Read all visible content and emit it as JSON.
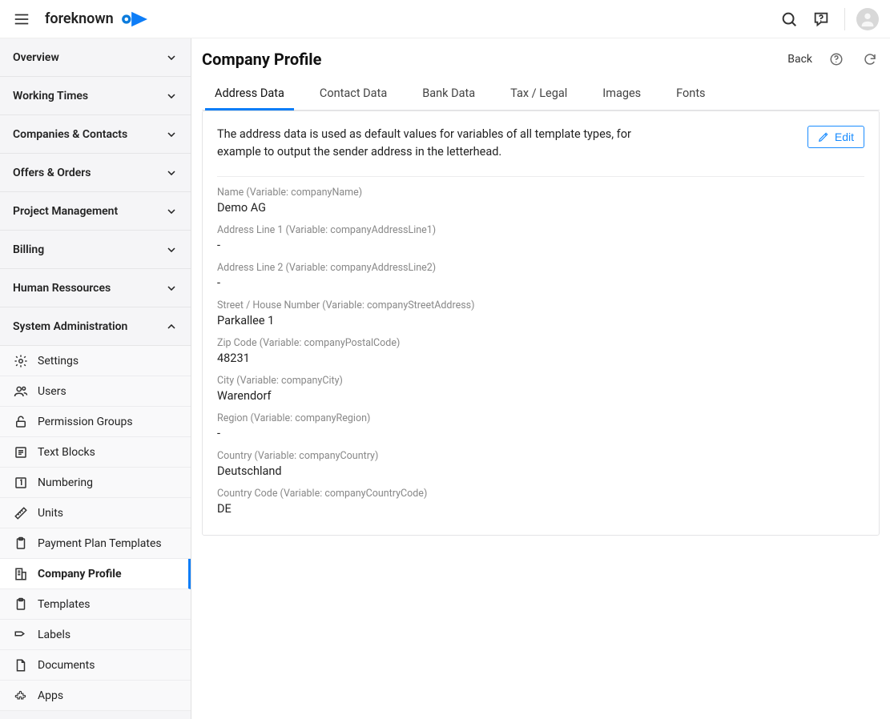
{
  "header": {
    "brand": "foreknown"
  },
  "sidebar": {
    "sections": [
      {
        "label": "Overview",
        "expanded": false
      },
      {
        "label": "Working Times",
        "expanded": false
      },
      {
        "label": "Companies & Contacts",
        "expanded": false
      },
      {
        "label": "Offers & Orders",
        "expanded": false
      },
      {
        "label": "Project Management",
        "expanded": false
      },
      {
        "label": "Billing",
        "expanded": false
      },
      {
        "label": "Human Ressources",
        "expanded": false
      },
      {
        "label": "System Administration",
        "expanded": true
      }
    ],
    "sysadmin_items": [
      {
        "label": "Settings"
      },
      {
        "label": "Users"
      },
      {
        "label": "Permission Groups"
      },
      {
        "label": "Text Blocks"
      },
      {
        "label": "Numbering"
      },
      {
        "label": "Units"
      },
      {
        "label": "Payment Plan Templates"
      },
      {
        "label": "Company Profile",
        "active": true
      },
      {
        "label": "Templates"
      },
      {
        "label": "Labels"
      },
      {
        "label": "Documents"
      },
      {
        "label": "Apps"
      }
    ]
  },
  "main": {
    "title": "Company Profile",
    "back_label": "Back",
    "tabs": [
      {
        "label": "Address Data",
        "active": true
      },
      {
        "label": "Contact Data"
      },
      {
        "label": "Bank Data"
      },
      {
        "label": "Tax / Legal"
      },
      {
        "label": "Images"
      },
      {
        "label": "Fonts"
      }
    ],
    "description": "The address data is used as default values for variables of all template types, for example to output the sender address in the letterhead.",
    "edit_label": "Edit",
    "fields": [
      {
        "label": "Name (Variable: companyName)",
        "value": "Demo AG"
      },
      {
        "label": "Address Line 1 (Variable: companyAddressLine1)",
        "value": "-"
      },
      {
        "label": "Address Line 2 (Variable: companyAddressLine2)",
        "value": "-"
      },
      {
        "label": "Street / House Number (Variable: companyStreetAddress)",
        "value": "Parkallee 1"
      },
      {
        "label": "Zip Code (Variable: companyPostalCode)",
        "value": "48231"
      },
      {
        "label": "City (Variable: companyCity)",
        "value": "Warendorf"
      },
      {
        "label": "Region (Variable: companyRegion)",
        "value": "-"
      },
      {
        "label": "Country (Variable: companyCountry)",
        "value": "Deutschland"
      },
      {
        "label": "Country Code (Variable: companyCountryCode)",
        "value": "DE"
      }
    ]
  }
}
